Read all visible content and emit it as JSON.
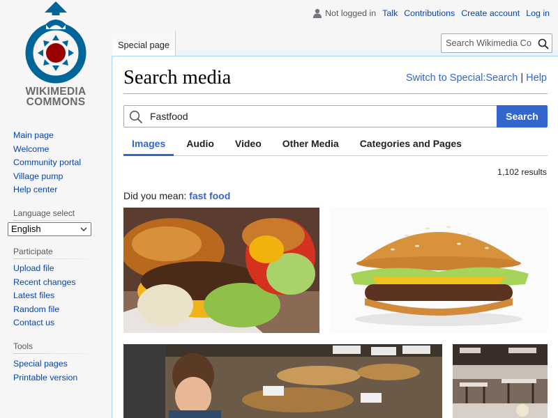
{
  "logo": {
    "line1": "WIKIMEDIA",
    "line2": "COMMONS"
  },
  "personal": {
    "not_logged_in": "Not logged in",
    "talk": "Talk",
    "contributions": "Contributions",
    "create_account": "Create account",
    "log_in": "Log in"
  },
  "tabs": {
    "special_page": "Special page"
  },
  "site_search": {
    "placeholder": "Search Wikimedia Co"
  },
  "sidebar": {
    "main": [
      "Main page",
      "Welcome",
      "Community portal",
      "Village pump",
      "Help center"
    ],
    "language_heading": "Language select",
    "language_value": "English",
    "participate_heading": "Participate",
    "participate": [
      "Upload file",
      "Recent changes",
      "Latest files",
      "Random file",
      "Contact us"
    ],
    "tools_heading": "Tools",
    "tools": [
      "Special pages",
      "Printable version"
    ]
  },
  "page": {
    "title": "Search media",
    "switch_link": "Switch to Special:Search",
    "separator": "|",
    "help_link": "Help"
  },
  "search": {
    "value": "Fastfood",
    "button": "Search"
  },
  "media_tabs": [
    "Images",
    "Audio",
    "Video",
    "Other Media",
    "Categories and Pages"
  ],
  "results": {
    "count": "1,102 results",
    "did_you_mean_label": "Did you mean:",
    "suggestion": "fast food"
  },
  "colors": {
    "accent": "#3366cc",
    "link": "#0645ad",
    "border": "#a7d7f9"
  }
}
